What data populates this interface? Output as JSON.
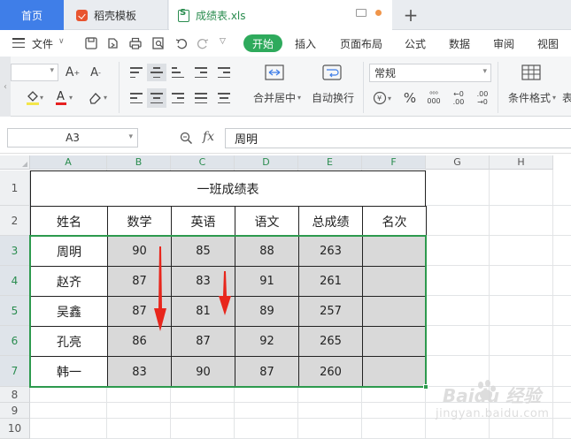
{
  "tabs": {
    "home": "首页",
    "template": "稻壳模板",
    "file": "成绩表.xls"
  },
  "menu": {
    "file": "文件",
    "start": "开始",
    "insert": "插入",
    "page_layout": "页面布局",
    "formula": "公式",
    "data": "数据",
    "review": "审阅",
    "view": "视图"
  },
  "ribbon": {
    "merge_center": "合并居中",
    "auto_wrap": "自动换行",
    "number_format": "常规",
    "cond_format": "条件格式",
    "percent": "%",
    "thousands": "000",
    "dec_increase": ".00",
    "dec_decrease": ".00"
  },
  "formula_bar": {
    "name_box": "A3",
    "fx": "fx",
    "content": "周明"
  },
  "columns": [
    "A",
    "B",
    "C",
    "D",
    "E",
    "F",
    "G",
    "H"
  ],
  "rows": [
    "1",
    "2",
    "3",
    "4",
    "5",
    "6",
    "7",
    "8",
    "9",
    "10"
  ],
  "table": {
    "title": "一班成绩表",
    "headers": [
      "姓名",
      "数学",
      "英语",
      "语文",
      "总成绩",
      "名次"
    ],
    "records": [
      [
        "周明",
        "90",
        "85",
        "88",
        "263",
        ""
      ],
      [
        "赵齐",
        "87",
        "83",
        "91",
        "261",
        ""
      ],
      [
        "吴鑫",
        "87",
        "81",
        "89",
        "257",
        ""
      ],
      [
        "孔亮",
        "86",
        "87",
        "92",
        "265",
        ""
      ],
      [
        "韩一",
        "83",
        "90",
        "87",
        "260",
        ""
      ]
    ]
  },
  "colors": {
    "accent": "#2eaa5c",
    "selection": "#2d9a4e",
    "arrow": "#e8261c",
    "home_tab": "#3f7ee8"
  },
  "watermark": {
    "brand": "Baidu 经验",
    "url": "jingyan.baidu.com"
  }
}
